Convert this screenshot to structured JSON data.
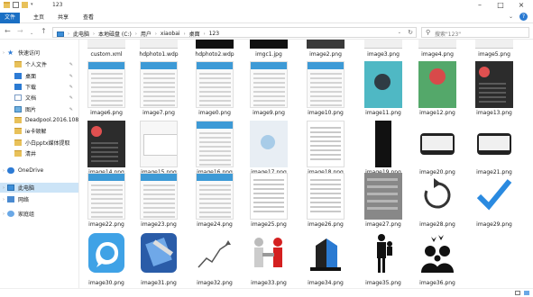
{
  "window": {
    "title": "123"
  },
  "ribbon": {
    "file": "文件",
    "home": "主页",
    "share": "共享",
    "view": "查看"
  },
  "address": {
    "crumbs": [
      "此电脑",
      "本地磁盘 (C:)",
      "用户",
      "xiaobai",
      "桌面",
      "123"
    ]
  },
  "search": {
    "placeholder": "搜索\"123\""
  },
  "sidebar": {
    "items": [
      {
        "label": "快速访问",
        "icon": "star-icon",
        "pinned": false
      },
      {
        "label": "个人文件",
        "icon": "folder-icon",
        "pinned": true
      },
      {
        "label": "桌面",
        "icon": "desktop-icon",
        "pinned": true
      },
      {
        "label": "下载",
        "icon": "download-icon",
        "pinned": true
      },
      {
        "label": "文档",
        "icon": "document-icon",
        "pinned": true
      },
      {
        "label": "图片",
        "icon": "picture-icon",
        "pinned": true
      },
      {
        "label": "Deadpool.2016.1080",
        "icon": "folder-icon",
        "pinned": false
      },
      {
        "label": "ie卡顿解",
        "icon": "folder-icon",
        "pinned": false
      },
      {
        "label": "小白pptx媒体提取",
        "icon": "folder-icon",
        "pinned": false
      },
      {
        "label": "清井",
        "icon": "folder-icon",
        "pinned": false
      },
      {
        "label": "OneDrive",
        "icon": "onedrive-icon",
        "pinned": false
      },
      {
        "label": "此电脑",
        "icon": "computer-icon",
        "pinned": false
      },
      {
        "label": "网络",
        "icon": "network-icon",
        "pinned": false
      },
      {
        "label": "家庭组",
        "icon": "homegroup-icon",
        "pinned": false
      }
    ]
  },
  "files": [
    {
      "name": "custom.xml",
      "thumb": "top-white"
    },
    {
      "name": "hdphoto1.wdp",
      "thumb": "top-white"
    },
    {
      "name": "hdphoto2.wdp",
      "thumb": "top-black"
    },
    {
      "name": "imgc1.jpg",
      "thumb": "top-black"
    },
    {
      "name": "image2.png",
      "thumb": "top-dark"
    },
    {
      "name": "image3.png",
      "thumb": "top-white"
    },
    {
      "name": "image4.png",
      "thumb": "top-white"
    },
    {
      "name": "image5.png",
      "thumb": "top-white"
    },
    {
      "name": "image6.png",
      "thumb": "phone"
    },
    {
      "name": "image7.png",
      "thumb": "phone"
    },
    {
      "name": "image0.png",
      "thumb": "phone"
    },
    {
      "name": "image9.png",
      "thumb": "phone"
    },
    {
      "name": "image10.png",
      "thumb": "phone"
    },
    {
      "name": "image11.png",
      "thumb": "teal"
    },
    {
      "name": "image12.png",
      "thumb": "green"
    },
    {
      "name": "image13.png",
      "thumb": "dark"
    },
    {
      "name": "image14.png",
      "thumb": "dark"
    },
    {
      "name": "image15.png",
      "thumb": "dialog"
    },
    {
      "name": "image16.png",
      "thumb": "phone"
    },
    {
      "name": "image17.png",
      "thumb": "map"
    },
    {
      "name": "image18.png",
      "thumb": "list"
    },
    {
      "name": "image19.png",
      "thumb": "black"
    },
    {
      "name": "image20.png",
      "thumb": "phonebig"
    },
    {
      "name": "image21.png",
      "thumb": "phonebig"
    },
    {
      "name": "image22.png",
      "thumb": "phone"
    },
    {
      "name": "image23.png",
      "thumb": "phone"
    },
    {
      "name": "image24.png",
      "thumb": "phone"
    },
    {
      "name": "image25.png",
      "thumb": "list"
    },
    {
      "name": "image26.png",
      "thumb": "list"
    },
    {
      "name": "image27.png",
      "thumb": "gray"
    },
    {
      "name": "image28.png",
      "thumb": "refresh"
    },
    {
      "name": "image29.png",
      "thumb": "checkmark"
    },
    {
      "name": "image30.png",
      "thumb": "chat-bubble"
    },
    {
      "name": "image31.png",
      "thumb": "xcode-hammer"
    },
    {
      "name": "image32.png",
      "thumb": "line-trend"
    },
    {
      "name": "image33.png",
      "thumb": "handshake"
    },
    {
      "name": "image34.png",
      "thumb": "building"
    },
    {
      "name": "image35.png",
      "thumb": "father-child"
    },
    {
      "name": "image36.png",
      "thumb": "family"
    }
  ],
  "colors": {
    "accent": "#1a6fc4",
    "selection": "#cce4f7",
    "checkmark": "#2a8ae0"
  }
}
